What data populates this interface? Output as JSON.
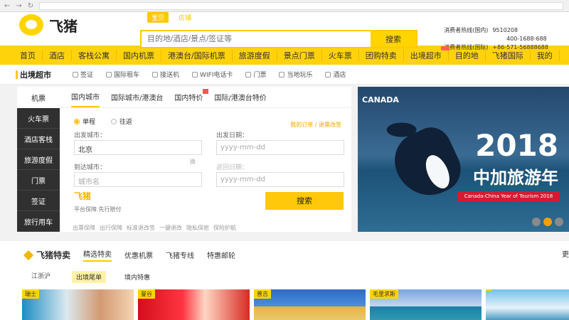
{
  "browser": {
    "back": "←",
    "forward": "→",
    "refresh": "↻"
  },
  "brand": {
    "name": "飞猪"
  },
  "search": {
    "tabs": [
      "宝贝",
      "店铺"
    ],
    "placeholder": "目的地/酒店/景点/签证等",
    "button": "搜索"
  },
  "hotline": {
    "domestic_label": "消费者热线(国内)",
    "domestic_number": "9510208",
    "domestic_number2": "400-1688-688",
    "intl_label": "消费者热线(国际)",
    "intl_number": "+86-571-56888688"
  },
  "nav": {
    "items": [
      "首页",
      "酒店",
      "客栈公寓",
      "国内机票",
      "港澳台/国际机票",
      "旅游度假",
      "景点门票",
      "火车票",
      "团购特卖",
      "出境超市",
      "目的地",
      "飞猪国际",
      "我的"
    ]
  },
  "subnav": {
    "title": "出境超市",
    "items": [
      "签证",
      "国际租车",
      "接送机",
      "WIFI电话卡",
      "门票",
      "当地玩乐",
      "酒店"
    ]
  },
  "booking": {
    "sidebar": [
      "机票",
      "火车票",
      "酒店客栈",
      "旅游度假",
      "门票",
      "签证",
      "旅行用车"
    ],
    "tabs": [
      "国内城市",
      "国际城市/港澳台",
      "国内特价",
      "国际/港澳台特价"
    ],
    "trip_types": [
      "单程",
      "往返"
    ],
    "order_link": "我的订单 / 退票改签",
    "depart_city_label": "出发城市：",
    "depart_city_value": "北京",
    "arrive_city_label": "到达城市：",
    "arrive_city_placeholder": "城市名",
    "depart_date_label": "出发日期：",
    "depart_date_placeholder": "yyyy-mm-dd",
    "return_date_label": "返回日期：",
    "return_date_placeholder": "yyyy-mm-dd",
    "swap": "换",
    "search_button": "搜索",
    "brand_text": "飞猪",
    "brand_subtext": "平台保障 先行赔付",
    "guarantees": [
      "出票保障",
      "出行保障",
      "标准退改签",
      "一键退改",
      "隐私保密",
      "保险护航"
    ]
  },
  "banner": {
    "brand": "CANADA",
    "year": "2018",
    "title": "中加旅游年",
    "ribbon": "Canada-China Year of Tourism 2018"
  },
  "deals": {
    "title": "飞猪特卖",
    "tabs": [
      "精选特卖",
      "优惠机票",
      "飞猪专线",
      "特惠邮轮"
    ],
    "more": "更",
    "region": "江浙沪",
    "filters": [
      "出境尾单",
      "境内特惠"
    ],
    "card_labels": [
      "瑞士",
      "曼谷",
      "普吉",
      "毛里求斯",
      ""
    ]
  }
}
